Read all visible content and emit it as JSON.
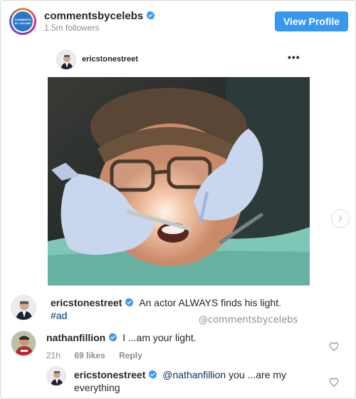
{
  "header": {
    "brand_name": "commentsbycelebs",
    "followers": "1.5m followers",
    "view_profile_label": "View Profile",
    "brand_avatar_lines": [
      "COMMENTS",
      "BY CELEBS"
    ]
  },
  "post": {
    "username": "ericstonestreet",
    "more_label": "•••"
  },
  "caption": {
    "username": "ericstonestreet",
    "text": "An actor ALWAYS finds his light.",
    "hashtag": "#ad",
    "watermark": "@commentsbycelebs"
  },
  "comment": {
    "username": "nathanfillion",
    "text": "I ...am your light.",
    "time": "21h",
    "likes": "69 likes",
    "reply_label": "Reply"
  },
  "reply": {
    "username": "ericstonestreet",
    "mention": "@nathanfillion",
    "text_line1": "you ...are my",
    "text_line2": "everything"
  },
  "colors": {
    "accent": "#3897f0",
    "verified": "#3897f0",
    "muted": "#8e8e8e",
    "text": "#262626",
    "mention": "#003569"
  }
}
